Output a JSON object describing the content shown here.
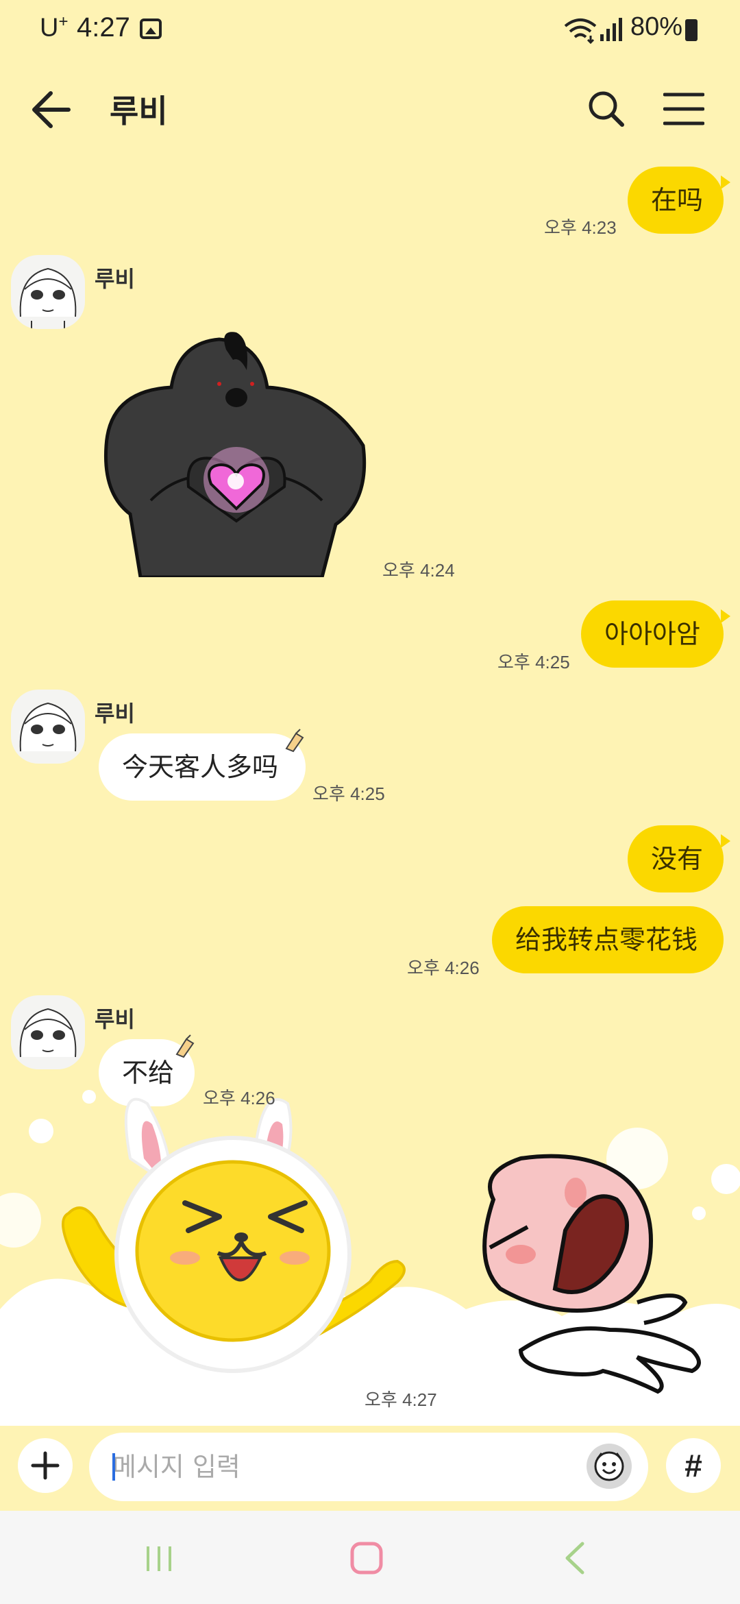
{
  "status_bar": {
    "carrier": "U",
    "carrier_sup": "+",
    "time": "4:27",
    "battery": "80%"
  },
  "header": {
    "title": "루비",
    "back_icon": "arrow-left-icon",
    "search_icon": "search-icon",
    "menu_icon": "hamburger-menu-icon"
  },
  "messages": [
    {
      "from": "me",
      "text": "在吗",
      "time": "오후 4:23"
    },
    {
      "from": "other",
      "sender": "루비",
      "type": "sticker",
      "sticker": "black-bird-heart-sticker",
      "time": "오후 4:24"
    },
    {
      "from": "me",
      "text": "아아아암",
      "time": "오후 4:25"
    },
    {
      "from": "other",
      "sender": "루비",
      "text": "今天客人多吗",
      "time": "오후 4:25"
    },
    {
      "from": "me",
      "text": "没有"
    },
    {
      "from": "me",
      "text": "给我转点零花钱",
      "time": "오후 4:26"
    },
    {
      "from": "other",
      "sender": "루비",
      "text": "不给",
      "time": "오후 4:26"
    },
    {
      "from": "me",
      "type": "sticker",
      "sticker": "rabbit-peach-cheer-sticker",
      "time": "오후 4:27"
    }
  ],
  "input": {
    "placeholder": "메시지 입력",
    "plus_icon": "plus-icon",
    "emoji_icon": "emoticon-icon",
    "hash_icon": "hash-icon",
    "hash_label": "#"
  },
  "nav": {
    "recents_icon": "recents-icon",
    "home_icon": "home-icon",
    "back_icon": "back-chevron-icon"
  },
  "colors": {
    "background": "#fef3b4",
    "my_bubble": "#fbd800",
    "other_bubble": "#ffffff"
  }
}
